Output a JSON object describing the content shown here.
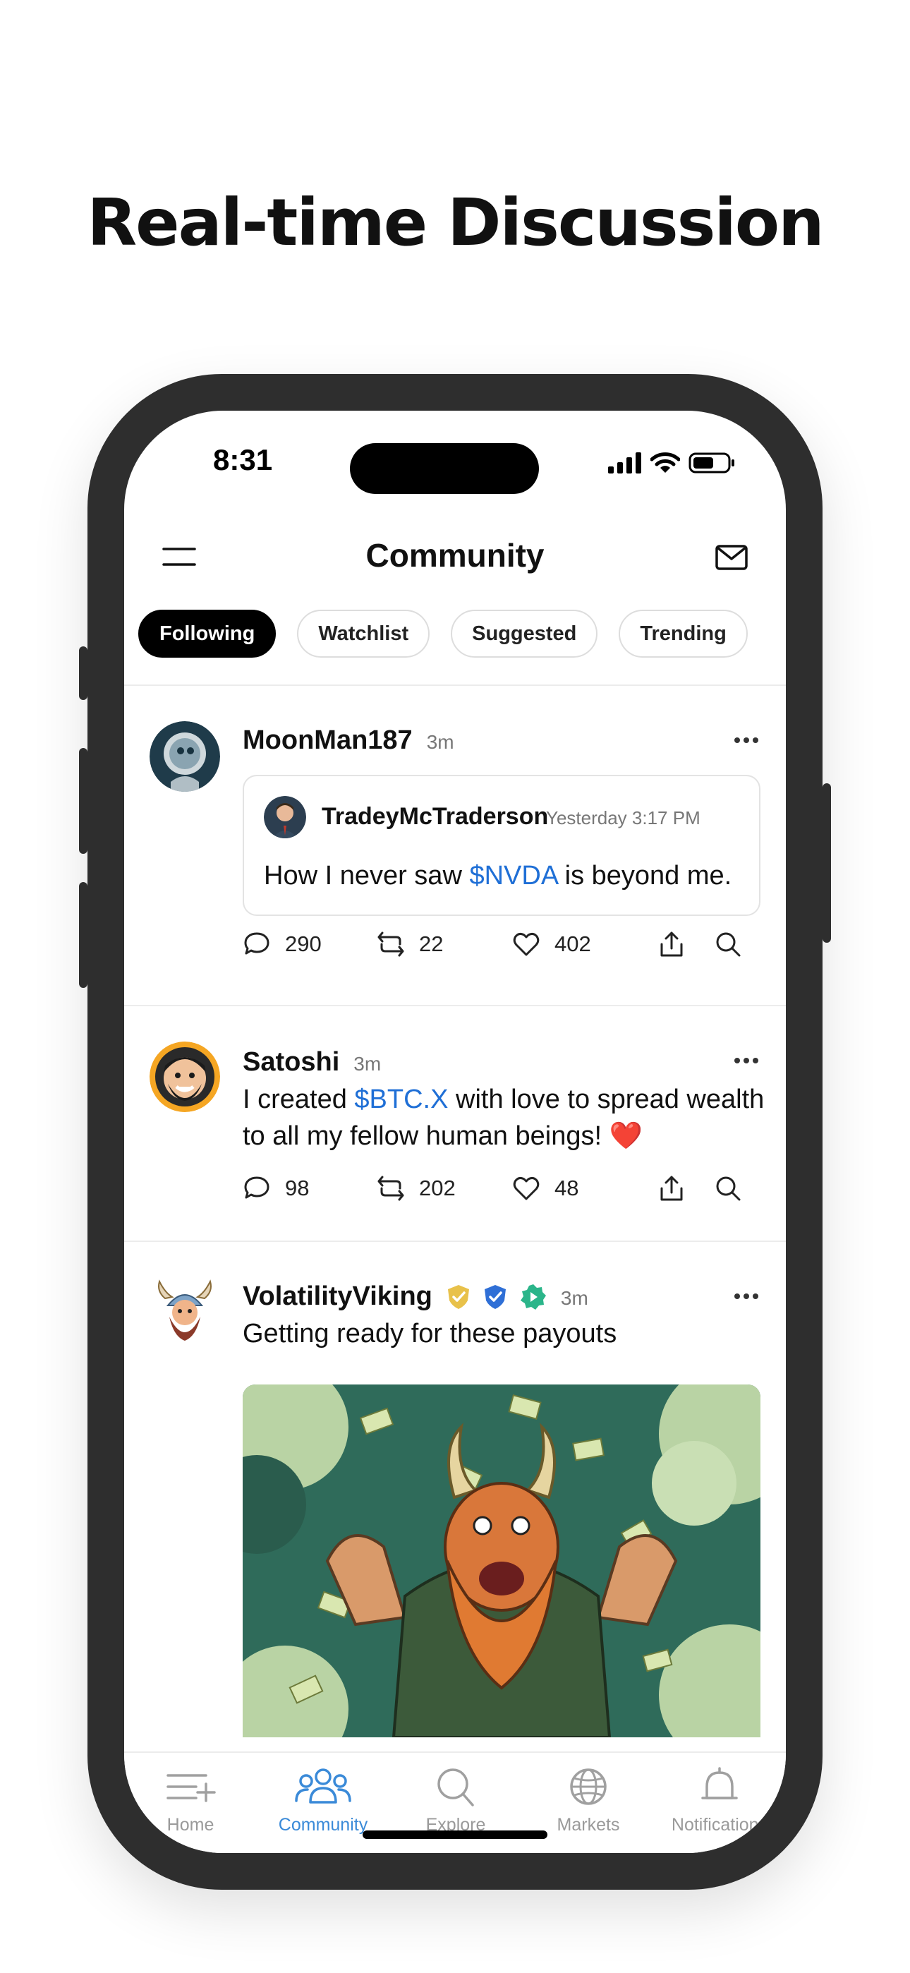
{
  "headline": "Real-time Discussion",
  "status_bar": {
    "time": "8:31"
  },
  "header": {
    "title": "Community"
  },
  "filters": [
    {
      "label": "Following",
      "active": true
    },
    {
      "label": "Watchlist",
      "active": false
    },
    {
      "label": "Suggested",
      "active": false
    },
    {
      "label": "Trending",
      "active": false
    }
  ],
  "posts": [
    {
      "username": "MoonMan187",
      "time": "3m",
      "quote": {
        "username": "TradeyMcTraderson",
        "time": "Yesterday 3:17 PM",
        "text_before": "How I never saw ",
        "ticker": "$NVDA",
        "text_after": " is beyond me."
      },
      "comments": "290",
      "reposts": "22",
      "likes": "402"
    },
    {
      "username": "Satoshi",
      "time": "3m",
      "text_before": "I created ",
      "ticker": "$BTC.X",
      "text_after": " with love to spread wealth to all my fellow human beings! ❤️",
      "comments": "98",
      "reposts": "202",
      "likes": "48"
    },
    {
      "username": "VolatilityViking",
      "time": "3m",
      "text": "Getting ready for these payouts"
    }
  ],
  "tabs": [
    {
      "label": "Home",
      "icon": "home-list-icon",
      "active": false
    },
    {
      "label": "Community",
      "icon": "people-icon",
      "active": true
    },
    {
      "label": "Explore",
      "icon": "search-icon",
      "active": false
    },
    {
      "label": "Markets",
      "icon": "globe-icon",
      "active": false
    },
    {
      "label": "Notifications",
      "icon": "bell-icon",
      "active": false
    }
  ],
  "colors": {
    "accent": "#3a8ad8",
    "ticker": "#1f6fd6",
    "frame": "#2e2e2e"
  }
}
